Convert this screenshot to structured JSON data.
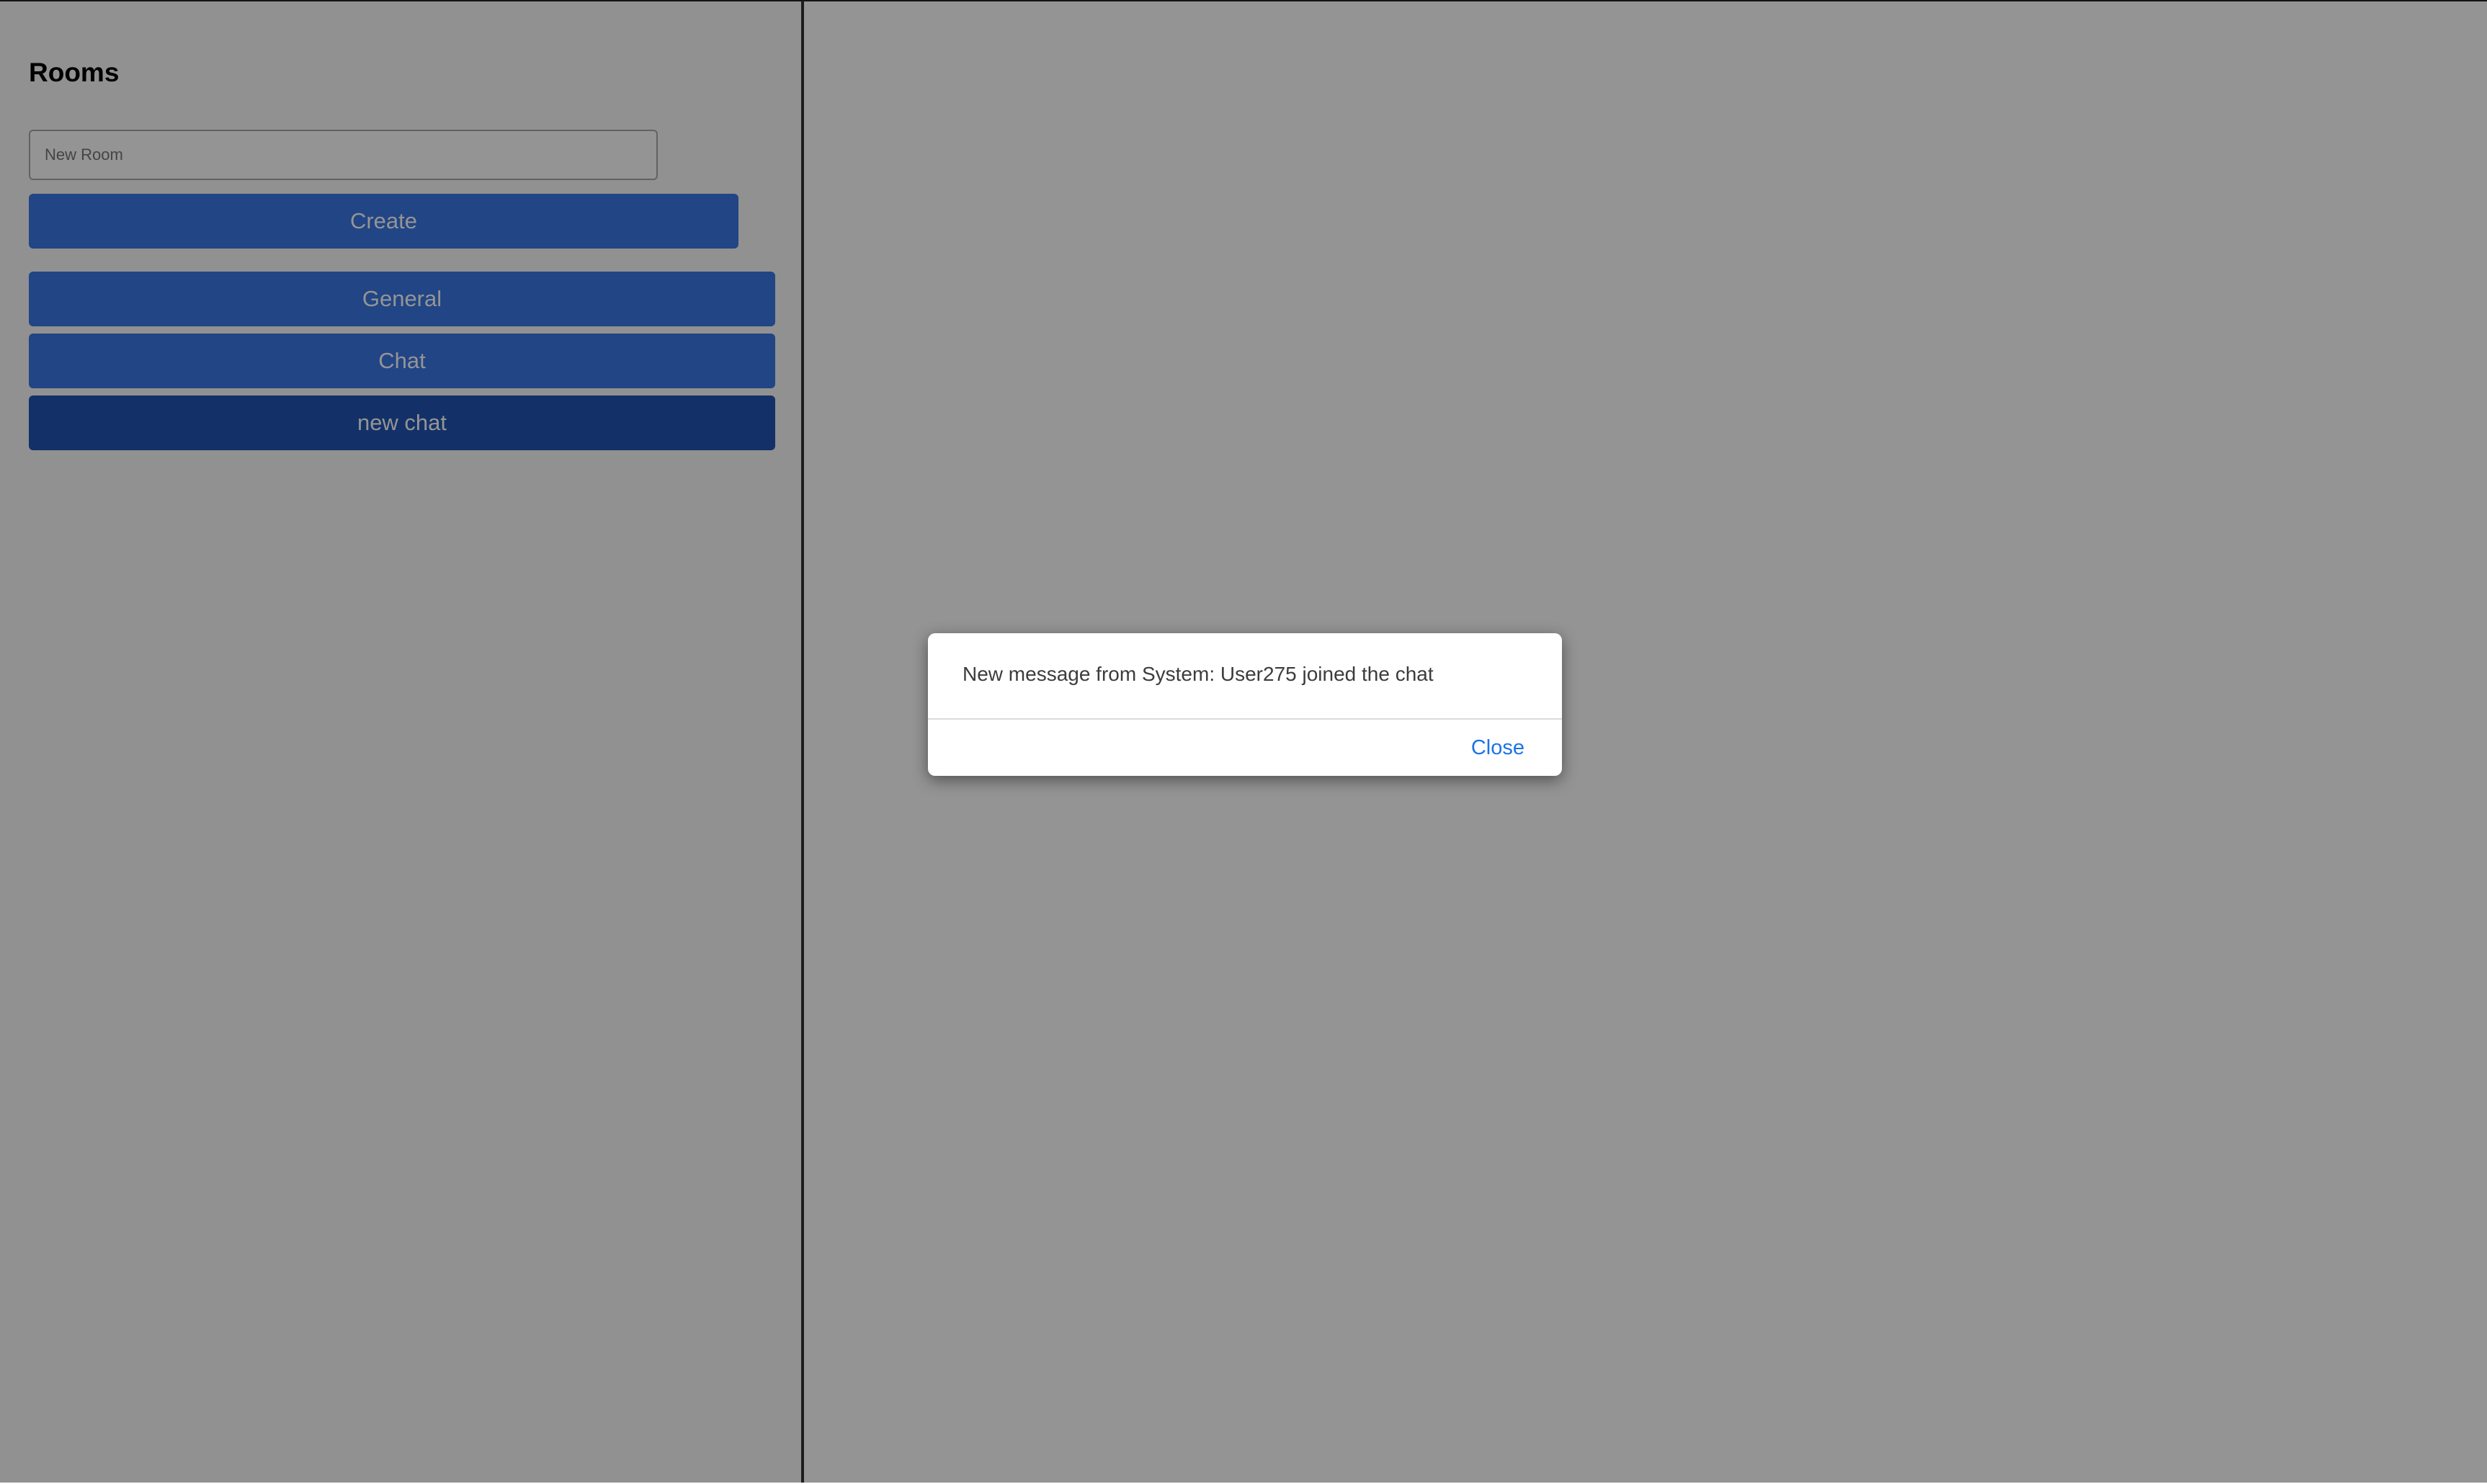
{
  "sidebar": {
    "title": "Rooms",
    "new_room_placeholder": "New Room",
    "new_room_value": "",
    "create_label": "Create",
    "rooms": [
      {
        "label": "General",
        "active": false
      },
      {
        "label": "Chat",
        "active": false
      },
      {
        "label": "new chat",
        "active": true
      }
    ]
  },
  "dialog": {
    "message": "New message from System: User275 joined the chat",
    "close_label": "Close"
  },
  "colors": {
    "button": "#3a78e6",
    "active_button": "#2255b3",
    "link": "#1a73e8"
  }
}
